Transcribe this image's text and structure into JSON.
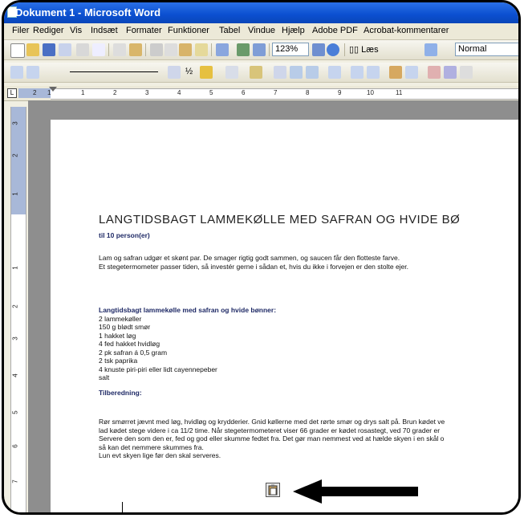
{
  "window": {
    "title": "Dokument 1 - Microsoft Word"
  },
  "menu": {
    "items": [
      "Filer",
      "Rediger",
      "Vis",
      "Indsæt",
      "Formater",
      "Funktioner",
      "Tabel",
      "Vindue",
      "Hjælp",
      "Adobe PDF",
      "Acrobat-kommentarer"
    ]
  },
  "toolbar": {
    "zoom": "123%",
    "read_label": "Læs",
    "style": "Normal",
    "font_size": "½"
  },
  "ruler": {
    "ticks": [
      "2",
      "1",
      "1",
      "2",
      "3",
      "4",
      "5",
      "6",
      "7",
      "8",
      "9",
      "10",
      "11"
    ],
    "vticks": [
      "3",
      "2",
      "1",
      "1",
      "2",
      "3",
      "4",
      "5",
      "6",
      "7"
    ]
  },
  "document": {
    "title": "LANGTIDSBAGT LAMMEKØLLE MED SAFRAN OG HVIDE BØ",
    "subtitle": "til 10 person(er)",
    "intro": [
      "Lam og safran udgør et skønt par. De smager rigtig godt sammen, og saucen får den flotteste farve.",
      "Et stegetermometer passer tiden, så investér gerne i sådan et, hvis du ikke i forvejen er den stolte ejer."
    ],
    "ingredients_heading": "Langtidsbagt lammekølle med safran og hvide bønner:",
    "ingredients": [
      "2 lammekøller",
      "150 g blødt smør",
      "1 hakket løg",
      "4 fed hakket hvidløg",
      "2 pk safran á 0,5 gram",
      "2 tsk paprika",
      "4 knuste piri-piri eller lidt cayennepeber",
      "salt"
    ],
    "method_heading": "Tilberedning:",
    "method": [
      "Rør smørret jævnt med løg, hvidløg og krydderier. Gnid køllerne med det rørte smør og drys salt på. Brun kødet ve",
      "lad kødet stege videre i ca 11/2 time. Når stegetermometeret viser 66 grader er kødet rosastegt, ved 70 grader er",
      "Servere den som den er, fed og god eller skumme fedtet fra. Det gør man nemmest ved at hælde skyen i en skål o",
      "så kan det nemmere skummes fra.",
      "Lun evt skyen lige før den skal serveres."
    ]
  },
  "colors": {
    "titlebar": "#0b4fd0",
    "heading_blue": "#1f2a66",
    "arrow": "#000000"
  }
}
